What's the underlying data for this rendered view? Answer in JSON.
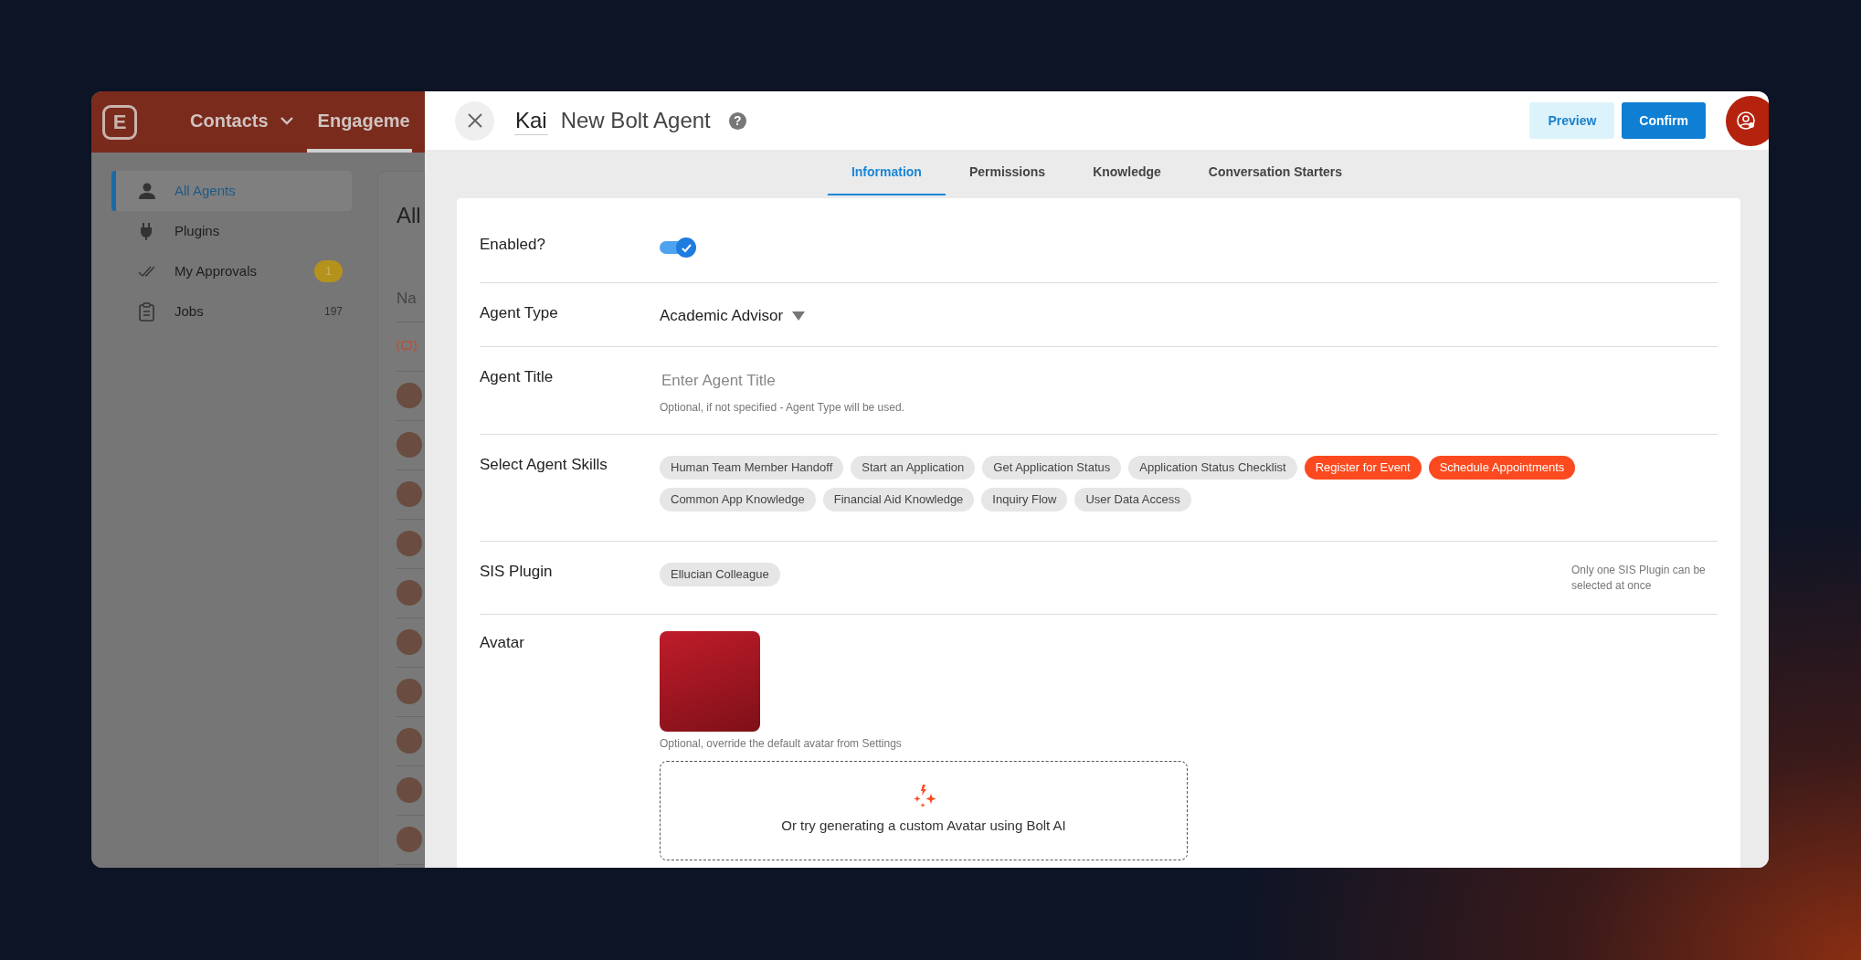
{
  "app": {
    "logo_letter": "E",
    "nav": [
      {
        "label": "Contacts",
        "selected": false,
        "dropdown": true
      },
      {
        "label": "Engageme",
        "selected": true,
        "dropdown": false
      }
    ],
    "sidebar": [
      {
        "label": "All Agents",
        "selected": true,
        "kind": "person"
      },
      {
        "label": "Plugins",
        "selected": false,
        "kind": "plug"
      },
      {
        "label": "My Approvals",
        "selected": false,
        "kind": "checks",
        "badge": "1"
      },
      {
        "label": "Jobs",
        "selected": false,
        "kind": "clipboard",
        "count": "197"
      }
    ],
    "list": {
      "title": "All",
      "column_header": "Na",
      "rows": [
        {
          "kind": "bot"
        },
        {
          "kind": "person"
        },
        {
          "kind": "person"
        },
        {
          "kind": "person"
        },
        {
          "kind": "person"
        },
        {
          "kind": "person"
        },
        {
          "kind": "person"
        },
        {
          "kind": "person"
        },
        {
          "kind": "person"
        },
        {
          "kind": "person"
        },
        {
          "kind": "person"
        }
      ]
    }
  },
  "modal": {
    "name": "Kai",
    "title": "New Bolt Agent",
    "help": "?",
    "buttons": [
      {
        "label": "Preview",
        "kind": "secondary"
      },
      {
        "label": "Confirm",
        "kind": "primary"
      }
    ],
    "tabs": [
      {
        "label": "Information",
        "selected": true
      },
      {
        "label": "Permissions",
        "selected": false
      },
      {
        "label": "Knowledge",
        "selected": false
      },
      {
        "label": "Conversation Starters",
        "selected": false
      }
    ],
    "fields": [
      {
        "kind": "toggle",
        "label": "Enabled?",
        "on": true
      },
      {
        "kind": "dropdown",
        "label": "Agent Type",
        "value": "Academic Advisor"
      },
      {
        "kind": "text",
        "label": "Agent Title",
        "placeholder": "Enter Agent Title",
        "hint": "Optional, if not specified - Agent Type will be used."
      },
      {
        "kind": "chips",
        "label": "Select Agent Skills",
        "chips": [
          {
            "label": "Human Team Member Handoff",
            "selected": false
          },
          {
            "label": "Start an Application",
            "selected": false
          },
          {
            "label": "Get Application Status",
            "selected": false
          },
          {
            "label": "Application Status Checklist",
            "selected": false
          },
          {
            "label": "Register for Event",
            "selected": true
          },
          {
            "label": "Schedule Appointments",
            "selected": true
          },
          {
            "label": "Common App Knowledge",
            "selected": false
          },
          {
            "label": "Financial Aid Knowledge",
            "selected": false
          },
          {
            "label": "Inquiry Flow",
            "selected": false
          },
          {
            "label": "User Data Access",
            "selected": false
          }
        ]
      },
      {
        "kind": "chips",
        "label": "SIS Plugin",
        "chips": [
          {
            "label": "Ellucian Colleague",
            "selected": false
          }
        ],
        "note": "Only one SIS Plugin can be selected at once"
      },
      {
        "kind": "avatar",
        "label": "Avatar",
        "hint": "Optional, override the default avatar from Settings",
        "generate_text": "Or try generating a custom Avatar using Bolt AI"
      }
    ]
  }
}
